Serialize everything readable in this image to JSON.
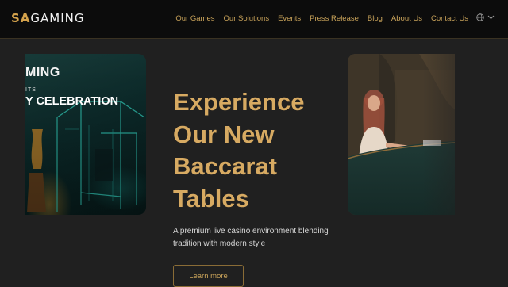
{
  "brand": {
    "prefix": "SA",
    "suffix": "GAMING"
  },
  "nav": {
    "items": [
      "Our Games",
      "Our Solutions",
      "Events",
      "Press Release",
      "Blog",
      "About Us",
      "Contact Us"
    ]
  },
  "language_icon": "globe-icon",
  "language_chevron": "chevron-down-icon",
  "left_card": {
    "line1": "MING",
    "line2": "ITS",
    "line3": "Y CELEBRATION"
  },
  "hero": {
    "title_lines": [
      "Experience",
      "Our New",
      "Baccarat",
      "Tables"
    ],
    "subtitle": "A premium live casino environment blending tradition with modern style",
    "cta": "Learn more"
  },
  "colors": {
    "accent_gold": "#d7aa62",
    "nav_gold": "#c9a35a",
    "background": "#202020",
    "topbar": "#0c0c0c"
  }
}
